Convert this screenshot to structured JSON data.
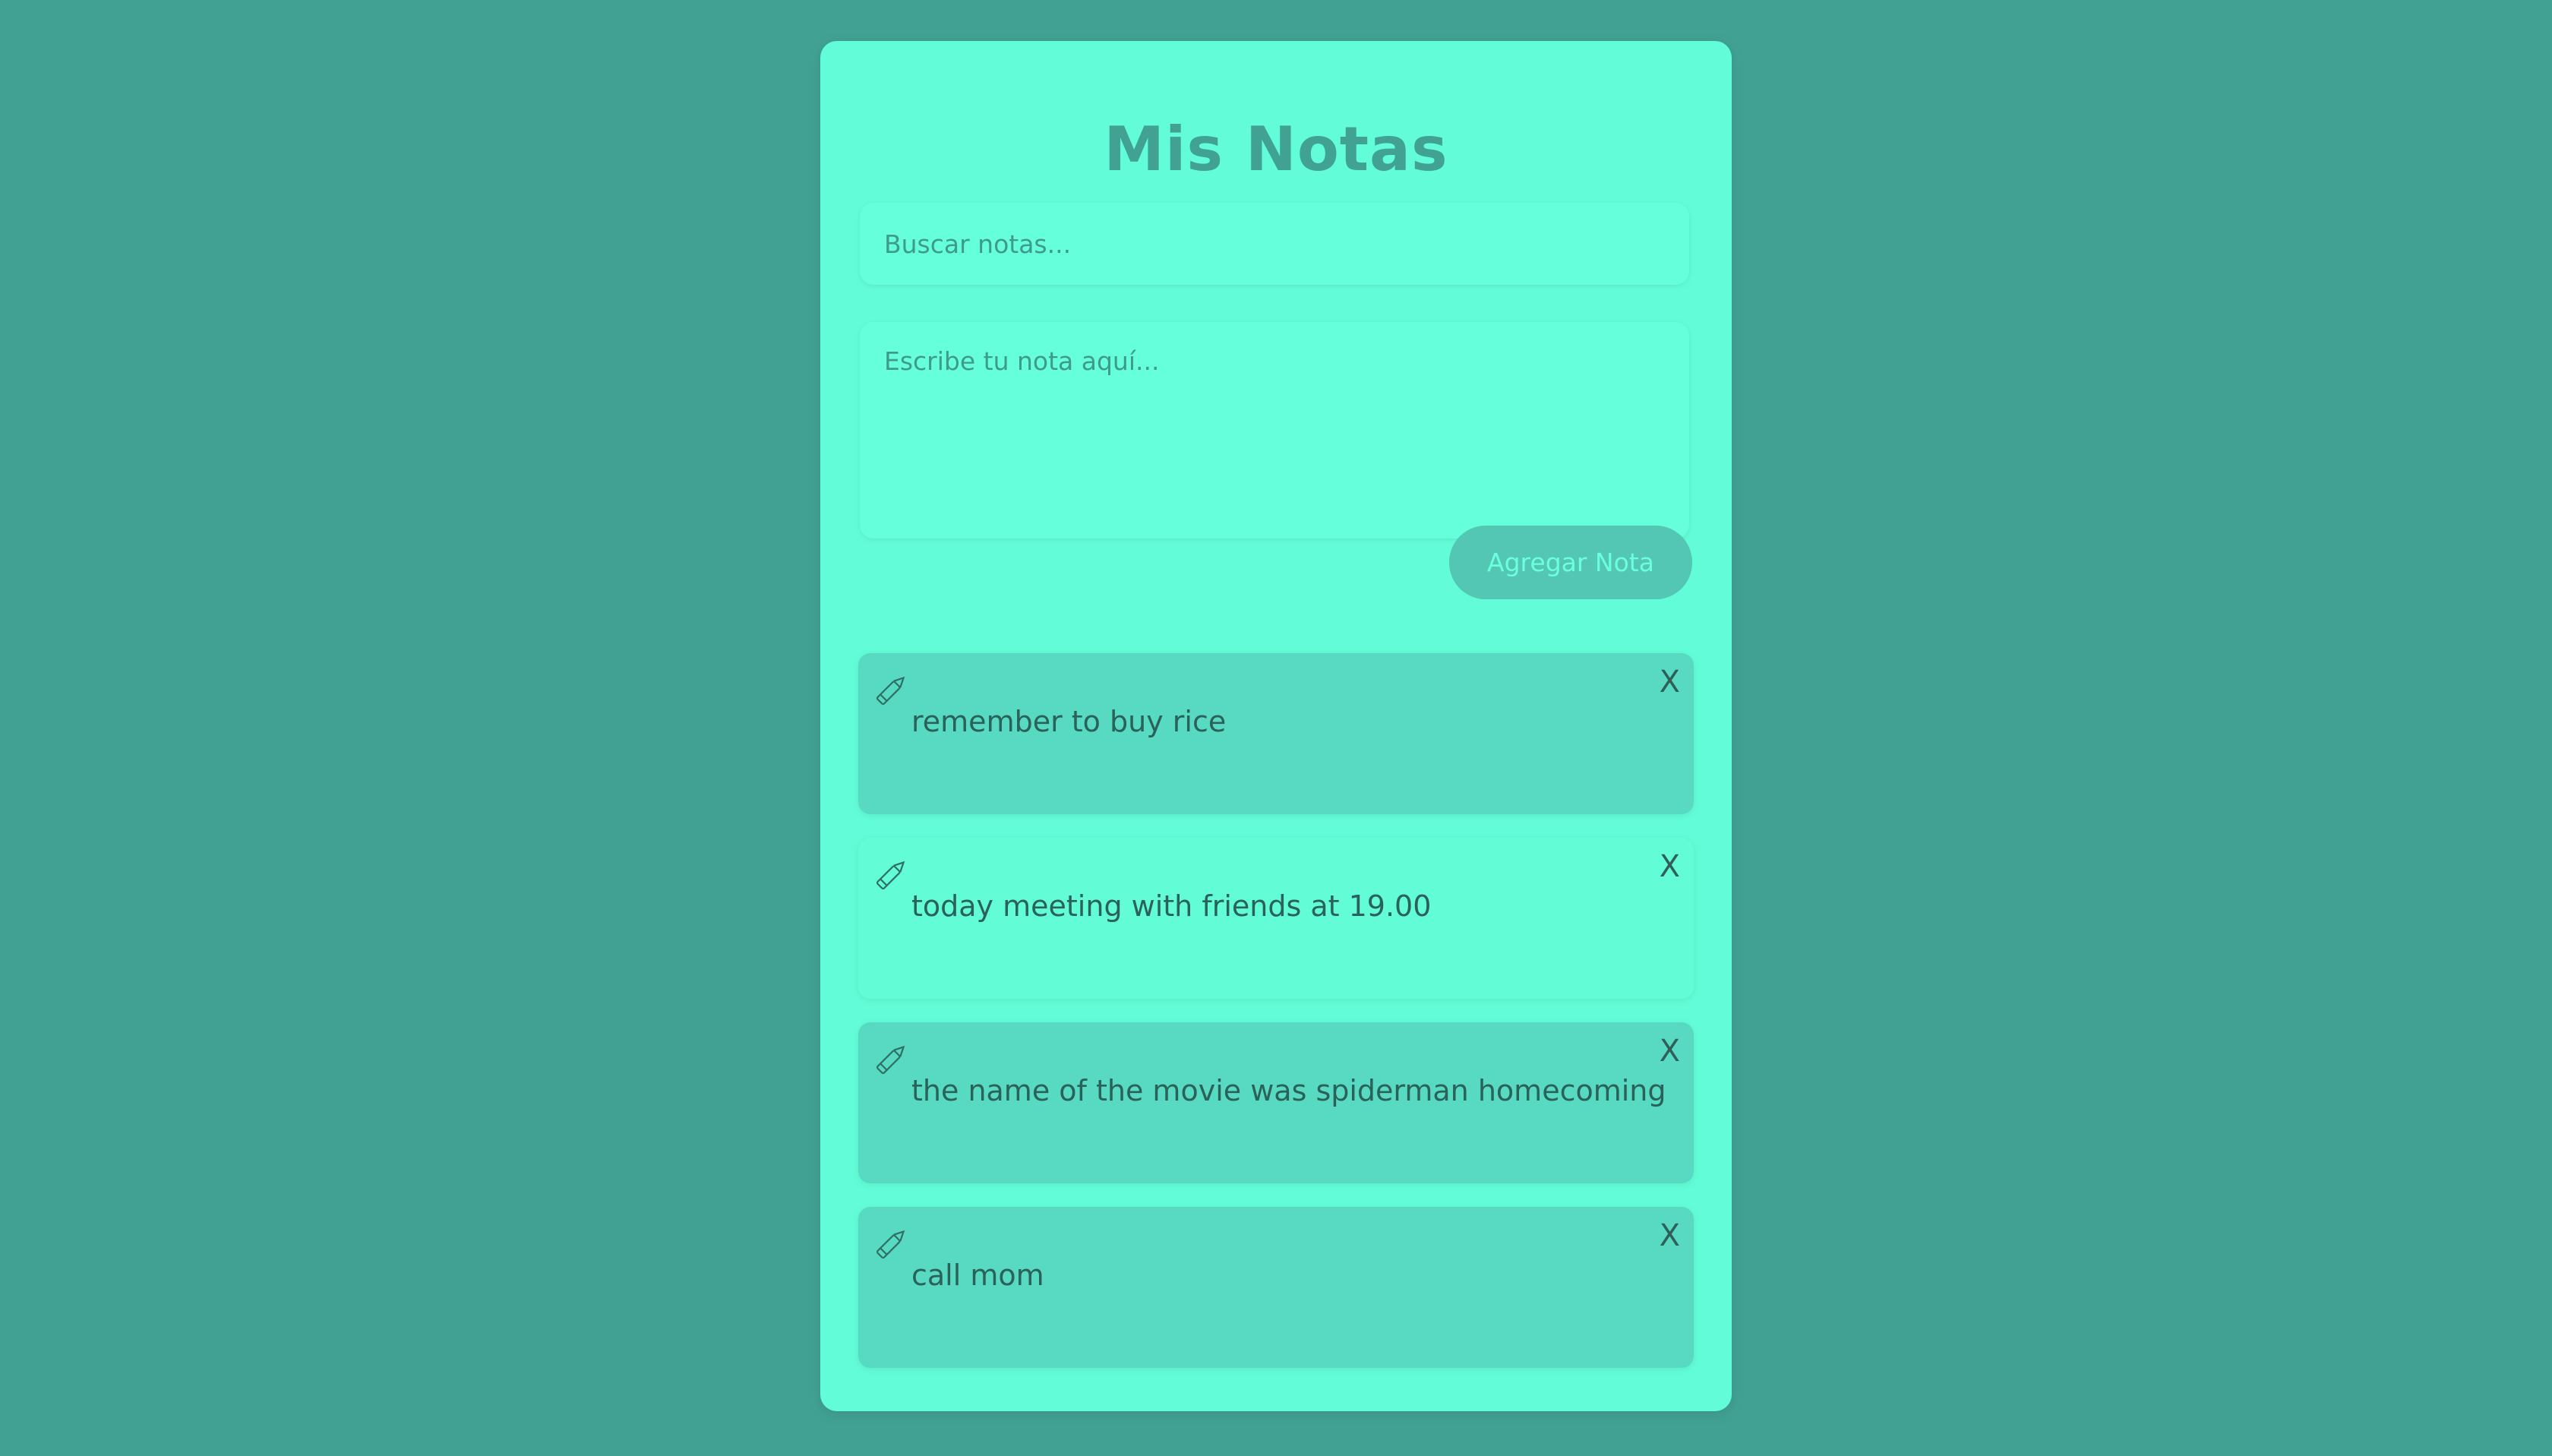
{
  "app": {
    "title": "Mis Notas"
  },
  "search": {
    "placeholder": "Buscar notas..."
  },
  "composer": {
    "placeholder": "Escribe tu nota aquí..."
  },
  "actions": {
    "add_label": "Agregar Nota"
  },
  "notes": [
    {
      "text": "remember to buy rice",
      "edit_icon": "pencil-icon",
      "delete_label": "X"
    },
    {
      "text": "today meeting with friends at 19.00",
      "edit_icon": "pencil-icon",
      "delete_label": "X"
    },
    {
      "text": "the name of the movie was spiderman homecoming",
      "edit_icon": "pencil-icon",
      "delete_label": "X"
    },
    {
      "text": "call mom",
      "edit_icon": "pencil-icon",
      "delete_label": "X"
    }
  ],
  "colors": {
    "background": "#41a294",
    "card": "#62fdd8",
    "accent": "#53c7b3",
    "note": "#58dac2",
    "note_highlight": "#62fcd6",
    "text": "#2a6158"
  }
}
